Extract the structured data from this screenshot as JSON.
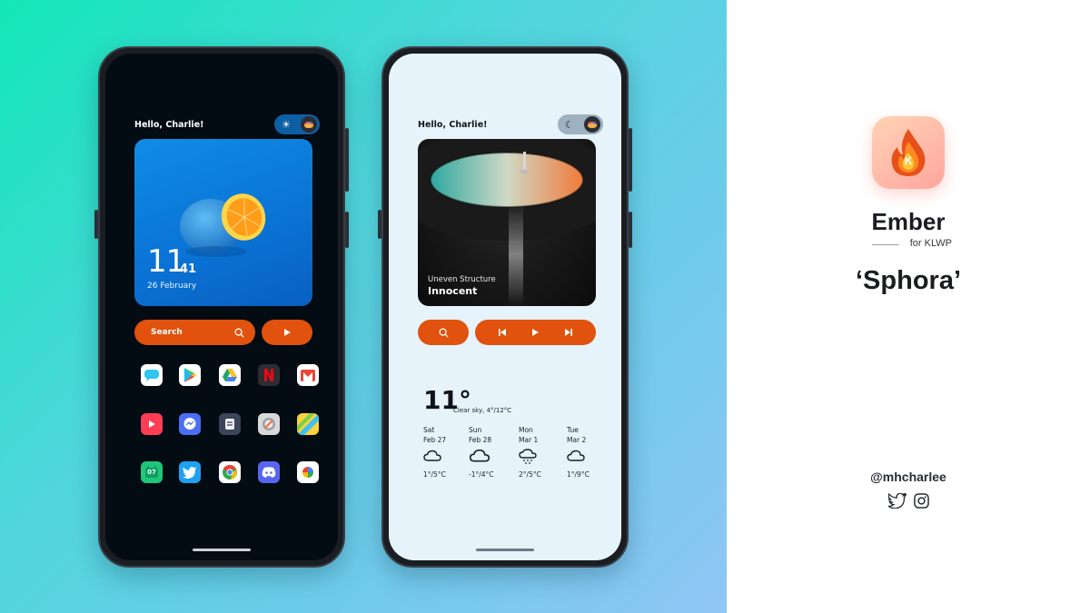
{
  "left_phone": {
    "greeting": "Hello, Charlie!",
    "toggle_icons": [
      "sun-icon",
      "palette-icon"
    ],
    "clock": {
      "hour": "11",
      "minute": "41",
      "date": "26 February"
    },
    "search_label": "Search",
    "apps": [
      [
        "messages-icon",
        "play-store-icon",
        "drive-icon",
        "netflix-icon",
        "gmail-icon"
      ],
      [
        "youtube-icon",
        "messenger-icon",
        "notes-icon",
        "camera-icon",
        "maps-icon"
      ],
      [
        "calendar-icon",
        "twitter-icon",
        "chrome-icon",
        "discord-icon",
        "photos-icon"
      ]
    ],
    "calendar_glyph": "07"
  },
  "right_phone": {
    "greeting": "Hello, Charlie!",
    "toggle_icons": [
      "moon-icon",
      "palette-icon"
    ],
    "music": {
      "artist": "Uneven Structure",
      "title": "Innocent"
    },
    "weather": {
      "temperature": "11°",
      "description": "Clear sky, 4°/12°C",
      "forecast": [
        {
          "day": "Sat",
          "date": "Feb 27",
          "icon": "cloud-icon",
          "range": "1°/5°C"
        },
        {
          "day": "Sun",
          "date": "Feb 28",
          "icon": "cloud-icon",
          "range": "-1°/4°C"
        },
        {
          "day": "Mon",
          "date": "Mar 1",
          "icon": "snow-cloud-icon",
          "range": "2°/5°C"
        },
        {
          "day": "Tue",
          "date": "Mar 2",
          "icon": "cloud-icon",
          "range": "1°/9°C"
        }
      ]
    }
  },
  "brand": {
    "logo_letter": "K",
    "name": "Ember",
    "subtitle": "for KLWP",
    "theme": "‘Sphora’",
    "handle": "@mhcharlee",
    "social_icons": [
      "twitter-icon",
      "instagram-icon"
    ]
  },
  "colors": {
    "accent": "#e0520d",
    "clock_card": "#0a72d4",
    "dark_screen": "#030b13",
    "light_screen": "#e6f3fb"
  }
}
